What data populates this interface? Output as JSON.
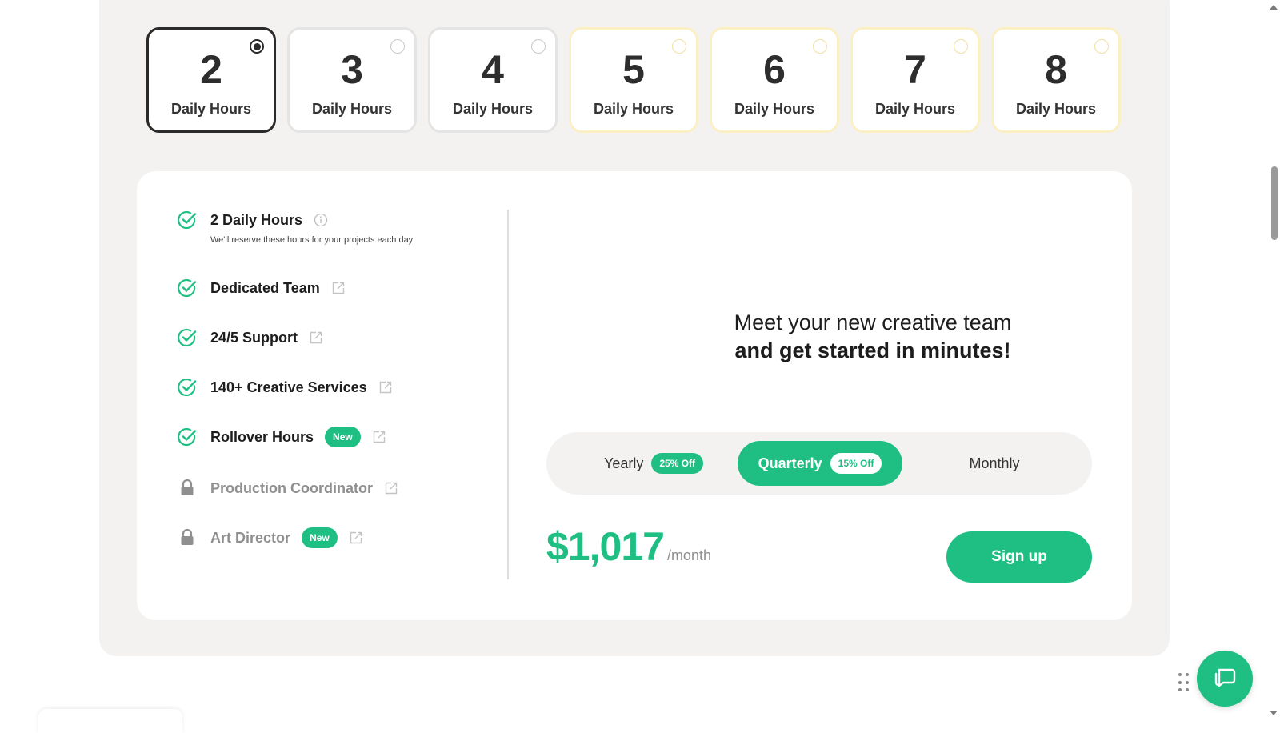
{
  "hour_options": [
    {
      "number": "2",
      "label": "Daily Hours",
      "selected": true,
      "tier": "standard"
    },
    {
      "number": "3",
      "label": "Daily Hours",
      "selected": false,
      "tier": "standard"
    },
    {
      "number": "4",
      "label": "Daily Hours",
      "selected": false,
      "tier": "standard"
    },
    {
      "number": "5",
      "label": "Daily Hours",
      "selected": false,
      "tier": "premium"
    },
    {
      "number": "6",
      "label": "Daily Hours",
      "selected": false,
      "tier": "premium"
    },
    {
      "number": "7",
      "label": "Daily Hours",
      "selected": false,
      "tier": "premium"
    },
    {
      "number": "8",
      "label": "Daily Hours",
      "selected": false,
      "tier": "premium"
    }
  ],
  "features": [
    {
      "label": "2 Daily Hours",
      "sub": "We'll reserve these hours for your projects each day",
      "icon": "check-circle-icon",
      "locked": false,
      "badge": null,
      "link_icon": "info-icon"
    },
    {
      "label": "Dedicated Team",
      "icon": "check-circle-icon",
      "locked": false,
      "badge": null,
      "link_icon": "external-link-icon"
    },
    {
      "label": "24/5 Support",
      "icon": "check-circle-icon",
      "locked": false,
      "badge": null,
      "link_icon": "external-link-icon"
    },
    {
      "label": "140+ Creative Services",
      "icon": "check-circle-icon",
      "locked": false,
      "badge": null,
      "link_icon": "external-link-icon"
    },
    {
      "label": "Rollover Hours",
      "icon": "check-circle-icon",
      "locked": false,
      "badge": "New",
      "link_icon": "external-link-icon"
    },
    {
      "label": "Production Coordinator",
      "icon": "lock-icon",
      "locked": true,
      "badge": null,
      "link_icon": "external-link-icon"
    },
    {
      "label": "Art Director",
      "icon": "lock-icon",
      "locked": true,
      "badge": "New",
      "link_icon": "external-link-icon"
    }
  ],
  "headline": {
    "line1": "Meet your new creative team",
    "line2": "and get started in minutes!"
  },
  "billing": {
    "options": [
      {
        "label": "Yearly",
        "badge": "25% Off",
        "active": false
      },
      {
        "label": "Quarterly",
        "badge": "15% Off",
        "active": true
      },
      {
        "label": "Monthly",
        "badge": null,
        "active": false
      }
    ]
  },
  "price": {
    "amount": "$1,017",
    "unit": "/month"
  },
  "signup_label": "Sign up",
  "colors": {
    "accent": "#1fbf83",
    "panel_bg": "#f4f2f0",
    "selected_border": "#2a2a2a",
    "premium_border": "#fbf0c5"
  }
}
